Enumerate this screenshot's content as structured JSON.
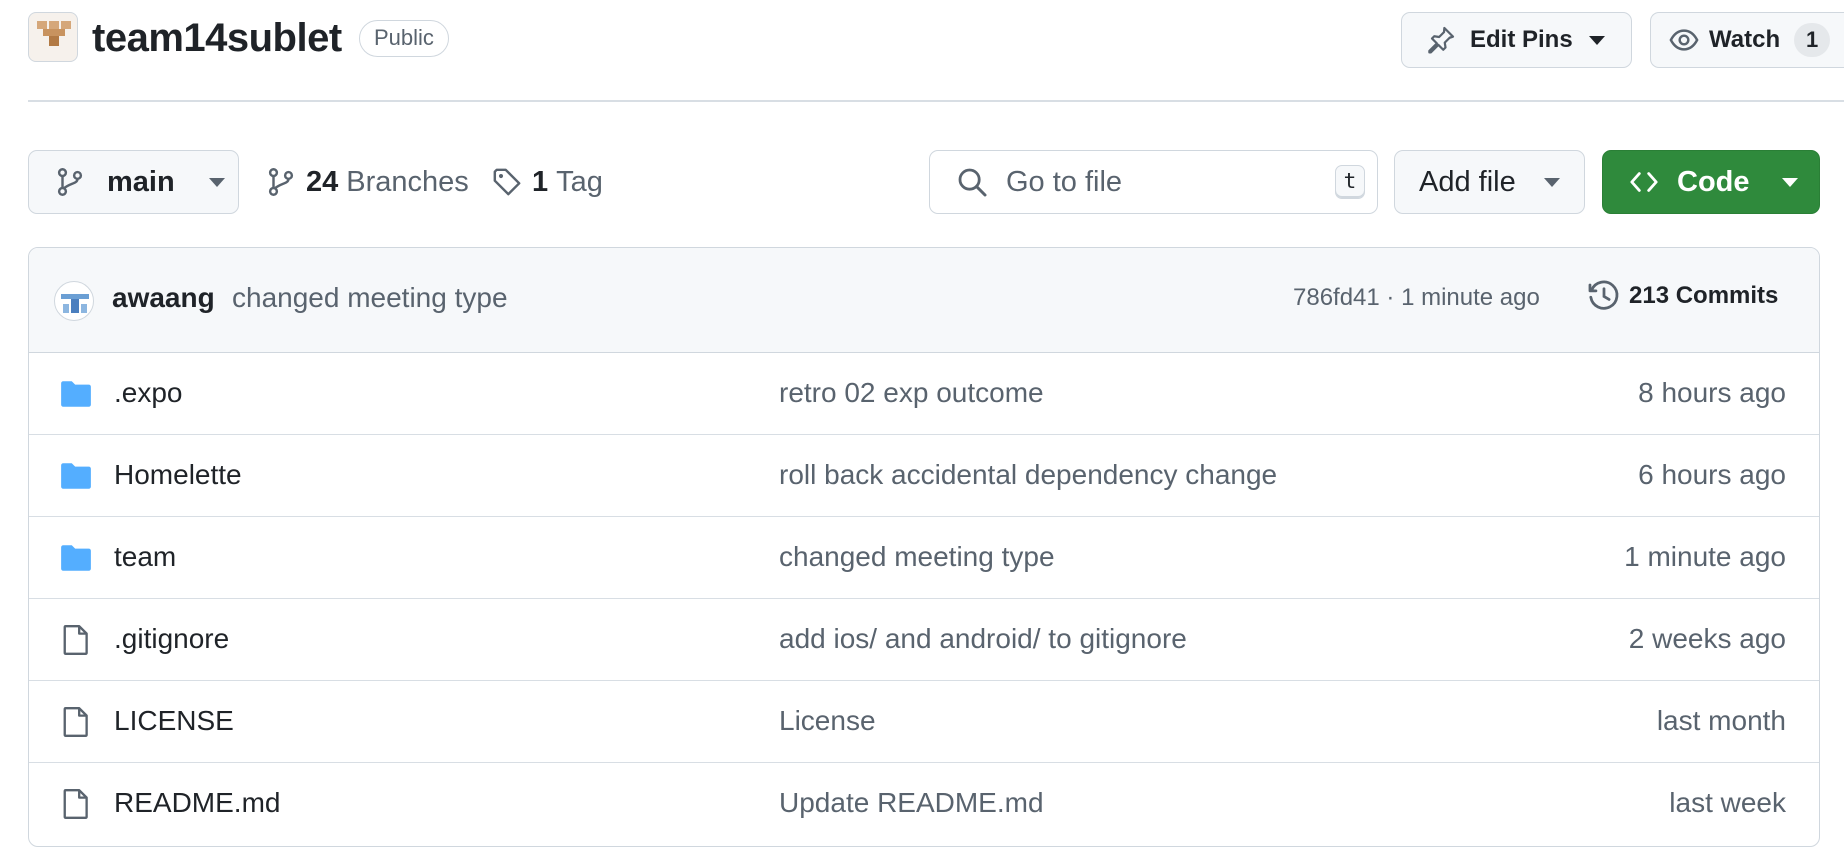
{
  "repo": {
    "name": "team14sublet",
    "visibility": "Public",
    "avatar_icon": "repo-logo-icon"
  },
  "header_actions": {
    "edit_pins_label": "Edit Pins",
    "watch_label": "Watch",
    "watch_count": "1"
  },
  "toolbar": {
    "branch": "main",
    "branches_count": "24",
    "branches_label": "Branches",
    "tags_count": "1",
    "tags_label": "Tag",
    "search_placeholder": "Go to file",
    "search_shortcut": "t",
    "add_file_label": "Add file",
    "code_label": "Code"
  },
  "latest_commit": {
    "author": "awaang",
    "message": "changed meeting type",
    "meta": "786fd41 · 1 minute ago",
    "commits_label": "213 Commits"
  },
  "files": [
    {
      "type": "folder",
      "name": ".expo",
      "commit": "retro 02 exp outcome",
      "time": "8 hours ago"
    },
    {
      "type": "folder",
      "name": "Homelette",
      "commit": "roll back accidental dependency change",
      "time": "6 hours ago"
    },
    {
      "type": "folder",
      "name": "team",
      "commit": "changed meeting type",
      "time": "1 minute ago"
    },
    {
      "type": "file",
      "name": ".gitignore",
      "commit": "add ios/ and android/ to gitignore",
      "time": "2 weeks ago"
    },
    {
      "type": "file",
      "name": "LICENSE",
      "commit": "License",
      "time": "last month"
    },
    {
      "type": "file",
      "name": "README.md",
      "commit": "Update README.md",
      "time": "last week"
    }
  ],
  "colors": {
    "code_button": "#2f8a3c",
    "folder_icon": "#54aeff",
    "muted_text": "#59636e",
    "border": "#d0d7de"
  }
}
